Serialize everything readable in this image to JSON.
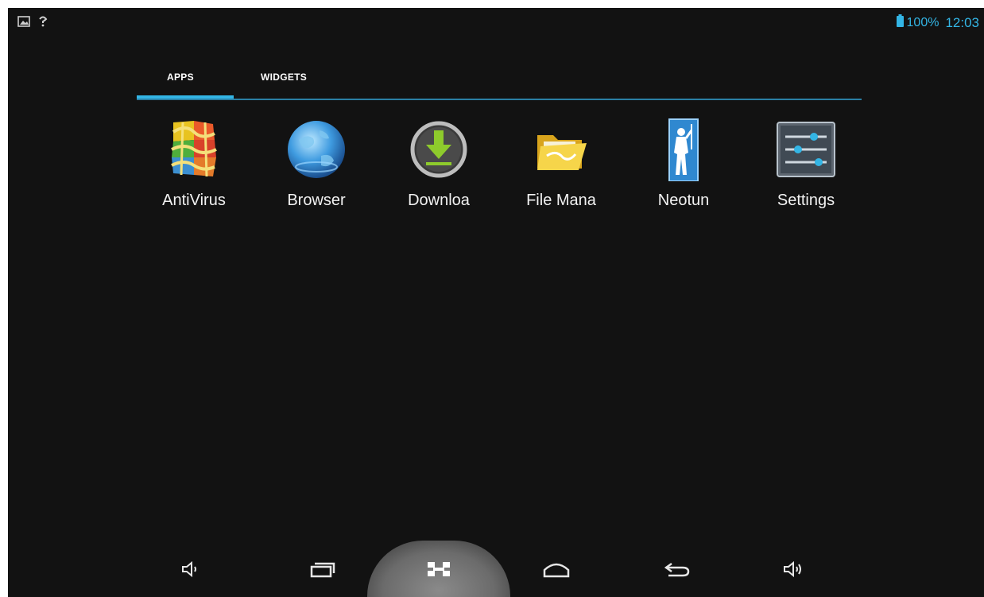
{
  "status_bar": {
    "battery": "100%",
    "clock": "12:03",
    "icons": [
      "picture-notification-icon",
      "wifi-question-icon",
      "battery-icon"
    ]
  },
  "tabs": [
    {
      "label": "APPS",
      "selected": true
    },
    {
      "label": "WIDGETS",
      "selected": false
    }
  ],
  "apps": [
    {
      "label": "AntiVirus",
      "icon": "avg-antivirus-icon"
    },
    {
      "label": "Browser",
      "icon": "globe-icon"
    },
    {
      "label": "Downloa",
      "icon": "download-icon"
    },
    {
      "label": "File Mana",
      "icon": "folder-icon"
    },
    {
      "label": "Neotun",
      "icon": "neotun-figure-icon"
    },
    {
      "label": "Settings",
      "icon": "settings-sliders-icon"
    }
  ],
  "nav_bar": {
    "buttons": [
      "volume-down-icon",
      "recent-apps-icon",
      "screenshot-icon",
      "home-icon",
      "back-icon",
      "volume-up-icon"
    ],
    "highlighted": "screenshot-icon"
  },
  "colors": {
    "accent": "#33b5e5",
    "background": "#121212",
    "text": "#f2f2f2"
  }
}
